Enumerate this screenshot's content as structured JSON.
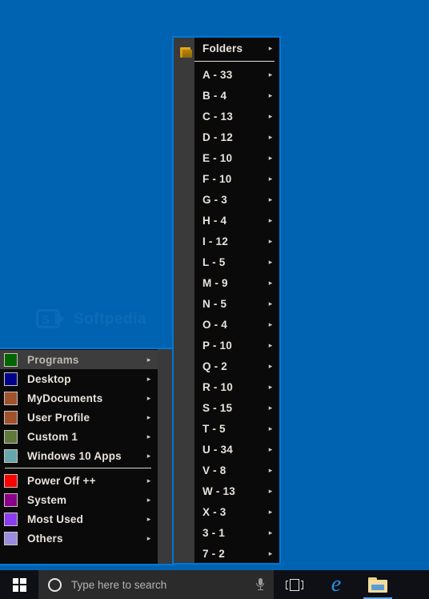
{
  "desktop": {
    "background_color": "#0063b1",
    "watermark_text": "Softpedia"
  },
  "folders_menu": {
    "header": {
      "label": "Folders",
      "icon": "folder-icon",
      "arrow": "▸"
    },
    "arrow": "▸",
    "items": [
      {
        "label": "A - 33"
      },
      {
        "label": "B - 4"
      },
      {
        "label": "C - 13"
      },
      {
        "label": "D - 12"
      },
      {
        "label": "E - 10"
      },
      {
        "label": "F - 10"
      },
      {
        "label": "G - 3"
      },
      {
        "label": "H - 4"
      },
      {
        "label": "I - 12"
      },
      {
        "label": "L - 5"
      },
      {
        "label": "M - 9"
      },
      {
        "label": "N - 5"
      },
      {
        "label": "O - 4"
      },
      {
        "label": "P - 10"
      },
      {
        "label": "Q - 2"
      },
      {
        "label": "R - 10"
      },
      {
        "label": "S - 15"
      },
      {
        "label": "T - 5"
      },
      {
        "label": "U - 34"
      },
      {
        "label": "V - 8"
      },
      {
        "label": "W - 13"
      },
      {
        "label": "X - 3"
      },
      {
        "label": "3 - 1"
      },
      {
        "label": "7 - 2"
      }
    ]
  },
  "main_menu": {
    "arrow": "▸",
    "group_one": [
      {
        "label": "Programs",
        "color": "#006400",
        "selected": true
      },
      {
        "label": "Desktop",
        "color": "#00008b",
        "selected": false
      },
      {
        "label": "MyDocuments",
        "color": "#a0522d",
        "selected": false
      },
      {
        "label": "User Profile",
        "color": "#a0522d",
        "selected": false
      },
      {
        "label": "Custom 1",
        "color": "#5f7a3a",
        "selected": false
      },
      {
        "label": "Windows 10 Apps",
        "color": "#66a5ab",
        "selected": false
      }
    ],
    "group_two": [
      {
        "label": "Power Off ++",
        "color": "#ff0000",
        "selected": false
      },
      {
        "label": "System",
        "color": "#8b008b",
        "selected": false
      },
      {
        "label": "Most Used",
        "color": "#8a3cf0",
        "selected": false
      },
      {
        "label": "Others",
        "color": "#9b8ce0",
        "selected": false
      }
    ]
  },
  "taskbar": {
    "start_label": "Start",
    "search": {
      "placeholder": "Type here to search",
      "value": ""
    },
    "mic_label": "Cortana microphone",
    "task_view_label": "Task View",
    "edge_label": "Microsoft Edge",
    "edge_glyph": "e",
    "explorer_label": "File Explorer"
  }
}
